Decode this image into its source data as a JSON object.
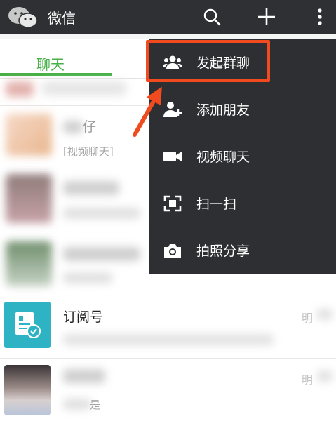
{
  "app": {
    "title": "微信"
  },
  "tabs": {
    "chat": "聊天"
  },
  "chat_list": {
    "row2_name_fragment": "仔",
    "row2_preview": "[视频聊天]",
    "subscription_name": "订阅号",
    "subscription_time_fragment": "明",
    "last_row_time_fragment": "明",
    "last_row_preview_fragment": "是"
  },
  "menu": {
    "items": [
      {
        "label": "发起群聊",
        "icon": "group-icon"
      },
      {
        "label": "添加朋友",
        "icon": "add-friend-icon"
      },
      {
        "label": "视频聊天",
        "icon": "video-camera-icon"
      },
      {
        "label": "扫一扫",
        "icon": "scan-icon"
      },
      {
        "label": "拍照分享",
        "icon": "camera-icon"
      }
    ]
  },
  "colors": {
    "accent": "#45b045",
    "highlight": "#f04a1e",
    "menu_bg": "#2d2f33",
    "topbar_bg": "#2e3033"
  }
}
